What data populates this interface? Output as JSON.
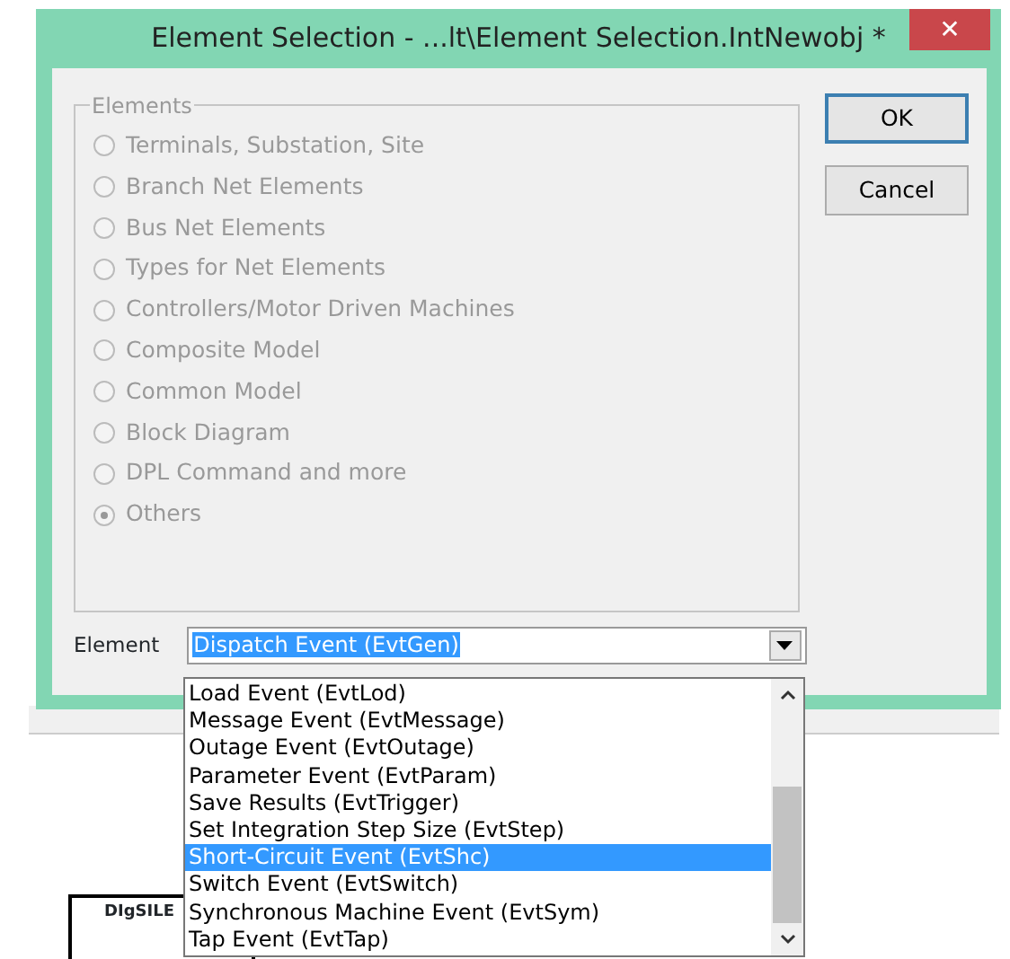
{
  "window": {
    "title": "Element Selection - ...lt\\Element Selection.IntNewobj *",
    "close": "✕"
  },
  "group": {
    "title": "Elements",
    "options": [
      {
        "label": "Terminals, Substation, Site",
        "selected": false,
        "disabled": true
      },
      {
        "label": "Branch Net Elements",
        "selected": false,
        "disabled": true
      },
      {
        "label": "Bus Net Elements",
        "selected": false,
        "disabled": true
      },
      {
        "label": "Types for Net Elements",
        "selected": false,
        "disabled": true
      },
      {
        "label": "Controllers/Motor Driven Machines",
        "selected": false,
        "disabled": true
      },
      {
        "label": "Composite Model",
        "selected": false,
        "disabled": true
      },
      {
        "label": "Common Model",
        "selected": false,
        "disabled": true
      },
      {
        "label": "Block Diagram",
        "selected": false,
        "disabled": true
      },
      {
        "label": "DPL Command and more",
        "selected": false,
        "disabled": true
      },
      {
        "label": "Others",
        "selected": true,
        "disabled": true
      }
    ]
  },
  "buttons": [
    "OK",
    "Cancel"
  ],
  "element": {
    "label": "Element",
    "value": "Dispatch Event (EvtGen)",
    "expanded": true,
    "items": [
      {
        "label": "Load Event (EvtLod)",
        "selected": false
      },
      {
        "label": "Message Event (EvtMessage)",
        "selected": false
      },
      {
        "label": "Outage Event (EvtOutage)",
        "selected": false
      },
      {
        "label": "Parameter Event (EvtParam)",
        "selected": false
      },
      {
        "label": "Save Results (EvtTrigger)",
        "selected": false
      },
      {
        "label": "Set Integration Step Size (EvtStep)",
        "selected": false
      },
      {
        "label": "Short-Circuit Event (EvtShc)",
        "selected": true
      },
      {
        "label": "Switch Event (EvtSwitch)",
        "selected": false
      },
      {
        "label": "Synchronous Machine Event (EvtSym)",
        "selected": false
      },
      {
        "label": "Tap Event (EvtTap)",
        "selected": false
      }
    ]
  },
  "background": {
    "box_text": "DIgSILE"
  }
}
